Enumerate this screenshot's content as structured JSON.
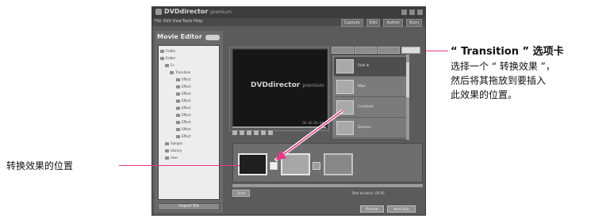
{
  "app": {
    "title": "DVDdirector",
    "title_suffix": "premium",
    "menus": [
      "File",
      "Edit",
      "View",
      "Tools",
      "Help"
    ],
    "toolbar": [
      "Capture",
      "Edit",
      "Author",
      "Burn"
    ],
    "left_panel_title": "Movie Editor",
    "tree_items": [
      "Folder",
      "Folder",
      "Fx",
      "Transition",
      "Effect",
      "Effect",
      "Effect",
      "Effect",
      "Effect",
      "Effect",
      "Effect",
      "Effect",
      "Effect",
      "Sample",
      "Library",
      "User"
    ],
    "left_bottom_label": "Import file",
    "preview_logo": "DVDdirector",
    "preview_logo_suffix": "premium",
    "preview_timecode": "00:00:00:00",
    "transitions": [
      "Fade In",
      "Wipe",
      "Crossfade",
      "Dissolve"
    ],
    "bottom_left_button": "Zoom",
    "bottom_text": "Total duration: 00:00",
    "action_buttons": [
      "Preview",
      "Next Step"
    ]
  },
  "annotations": {
    "tab_heading": "“ Transition ” 选项卡",
    "tab_desc": [
      "选择一个 “ 转换效果 ”，",
      "然后将其拖放到要插入",
      "此效果的位置。"
    ],
    "position_label": "转换效果的位置"
  },
  "colors": {
    "leader": "#e8388a",
    "arrow": "#e8388a"
  }
}
